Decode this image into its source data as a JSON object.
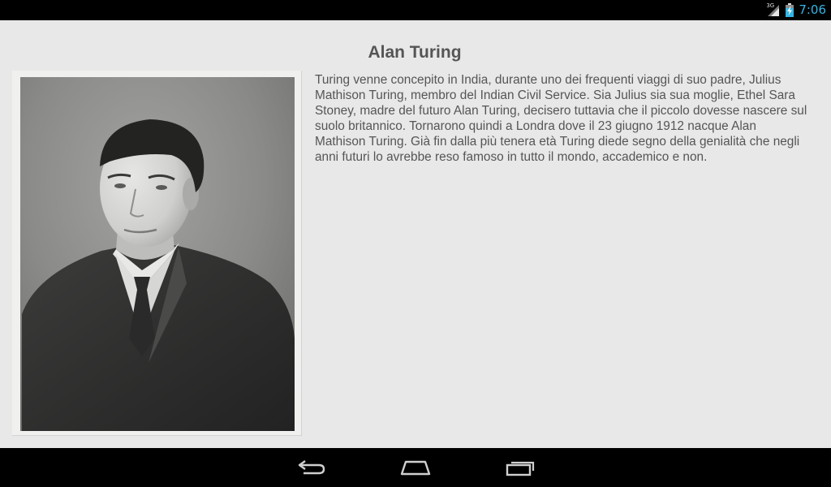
{
  "status_bar": {
    "network_type": "3G",
    "time": "7:06",
    "icons": [
      "signal-icon",
      "battery-charging-icon"
    ],
    "clock_color": "#33b5e5"
  },
  "content": {
    "title": "Alan Turing",
    "portrait_image": "alan-turing-portrait",
    "bio": "Turing venne concepito in India, durante uno dei frequenti viaggi di suo padre, Julius Mathison Turing, membro del Indian Civil Service. Sia Julius sia sua moglie, Ethel Sara Stoney, madre del futuro Alan Turing, decisero tuttavia che il piccolo dovesse nascere sul suolo britannico. Tornarono quindi a Londra dove il 23 giugno 1912 nacque Alan Mathison Turing. Già fin dalla più tenera età Turing diede segno della genialità che negli anni futuri lo avrebbe reso famoso in tutto il mondo, accademico e non."
  },
  "nav_bar": {
    "buttons": [
      "back-icon",
      "home-icon",
      "recents-icon"
    ]
  },
  "colors": {
    "background": "#e8e8e8",
    "text": "#555555",
    "bars": "#000000"
  }
}
